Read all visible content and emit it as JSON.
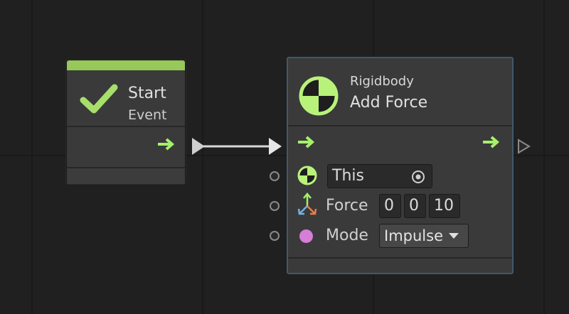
{
  "canvas": {
    "background": "#202020",
    "grid_color": "#191919"
  },
  "start_node": {
    "title": "Start",
    "subtitle": "Event",
    "accent": "#96c85a",
    "icon": "checkmark-icon",
    "control_output_icon": "arrow-right-icon"
  },
  "connection": {
    "color": "#d8d8d8"
  },
  "force_node": {
    "category": "Rigidbody",
    "title": "Add Force",
    "icon": "rigidbody-icon",
    "border_color": "#3e5a6e",
    "control_input_icon": "arrow-right-icon",
    "control_output_icon": "arrow-right-icon",
    "ports": [
      {
        "icon": "rigidbody-icon",
        "label": "",
        "value": "This",
        "picker_icon": "target-icon"
      },
      {
        "icon": "axes-icon",
        "label": "Force",
        "values": [
          "0",
          "0",
          "10"
        ]
      },
      {
        "icon": "enum-dot-icon",
        "label": "Mode",
        "value": "Impulse",
        "dropdown_icon": "caret-down-icon",
        "dot_color": "#d67fd6"
      }
    ]
  },
  "colors": {
    "flow_green": "#a6f06a",
    "arrow_grey": "#cfcfcf"
  }
}
